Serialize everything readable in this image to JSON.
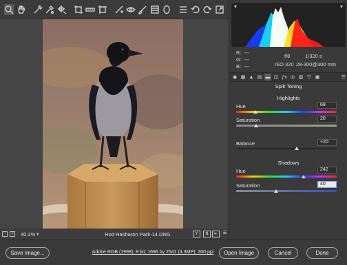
{
  "toolbar": {
    "tools": [
      "zoom-icon",
      "hand-icon",
      "white-balance-icon",
      "color-sampler-icon",
      "target-adjust-icon",
      "crop-icon",
      "straighten-icon",
      "transform-icon",
      "spot-removal-icon",
      "red-eye-icon",
      "adjustment-brush-icon",
      "graduated-filter-icon",
      "radial-filter-icon",
      "presets-list-icon",
      "rotate-left-icon",
      "rotate-right-icon"
    ],
    "right_tool": "toggle-fullscreen-icon"
  },
  "canvas": {
    "zoom": "40.2%",
    "filename": "Hod Hasharon Park-14.DNG"
  },
  "histogram": {
    "colors": {
      "red": "#ff1a1a",
      "green": "#1ee81e",
      "blue": "#1a3cff",
      "cyan": "#18e0ff",
      "yellow": "#ffe11a",
      "white": "#ffffff"
    }
  },
  "readout": {
    "r": "R:",
    "r_val": "---",
    "g": "G:",
    "g_val": "---",
    "b": "B:",
    "b_val": "---"
  },
  "camera": {
    "aperture": "f/8",
    "shutter": "1/320 s",
    "iso": "ISO 320",
    "lens": "28-300@300 mm"
  },
  "panel": {
    "title": "Split Toning",
    "highlights": {
      "heading": "Highlights",
      "hue_label": "Hue",
      "hue_value": "68",
      "hue_level": 68,
      "sat_label": "Saturation",
      "sat_value": "20",
      "sat_level": 20
    },
    "balance": {
      "label": "Balance",
      "value": "+20",
      "level": 20
    },
    "shadows": {
      "heading": "Shadows",
      "hue_label": "Hue",
      "hue_value": "242",
      "hue_level": 242,
      "sat_label": "Saturation",
      "sat_value": "40",
      "sat_level": 40
    }
  },
  "bottom": {
    "save": "Save Image...",
    "workflow": "Adobe RGB (1998); 8 bit; 1696 by 2541 (4.3MP); 300 ppi",
    "open": "Open Image",
    "cancel": "Cancel",
    "done": "Done"
  }
}
